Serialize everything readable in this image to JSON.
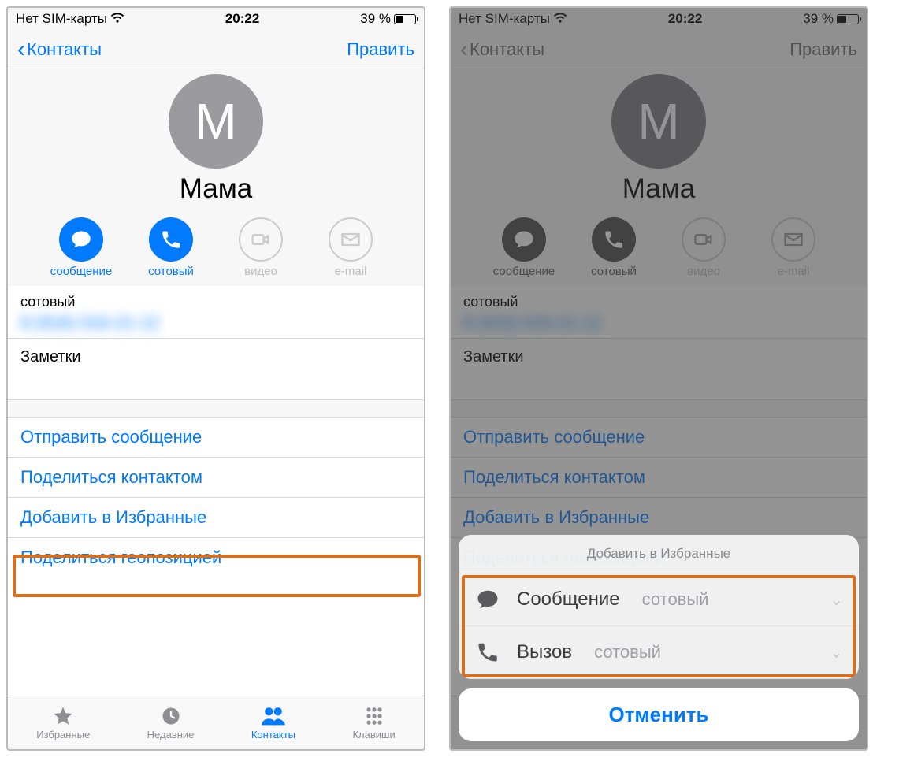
{
  "status": {
    "carrier": "Нет SIM-карты",
    "time": "20:22",
    "battery_pct": "39 %"
  },
  "nav": {
    "back": "Контакты",
    "edit": "Править"
  },
  "contact": {
    "initial": "М",
    "name": "Мама"
  },
  "actions": {
    "message": "сообщение",
    "mobile": "сотовый",
    "video": "видео",
    "email": "e-mail"
  },
  "details": {
    "phone_label": "сотовый",
    "phone_number": "8 (916) 016-21-12",
    "notes": "Заметки"
  },
  "rows": {
    "send_message": "Отправить сообщение",
    "share_contact": "Поделиться контактом",
    "add_favorite": "Добавить в Избранные",
    "share_location": "Поделиться геопозицией"
  },
  "tabs": {
    "favorites": "Избранные",
    "recents": "Недавние",
    "contacts": "Контакты",
    "keypad": "Клавиши"
  },
  "sheet": {
    "title": "Добавить в Избранные",
    "msg": "Сообщение",
    "msg_sub": "сотовый",
    "call": "Вызов",
    "call_sub": "сотовый",
    "cancel": "Отменить"
  }
}
